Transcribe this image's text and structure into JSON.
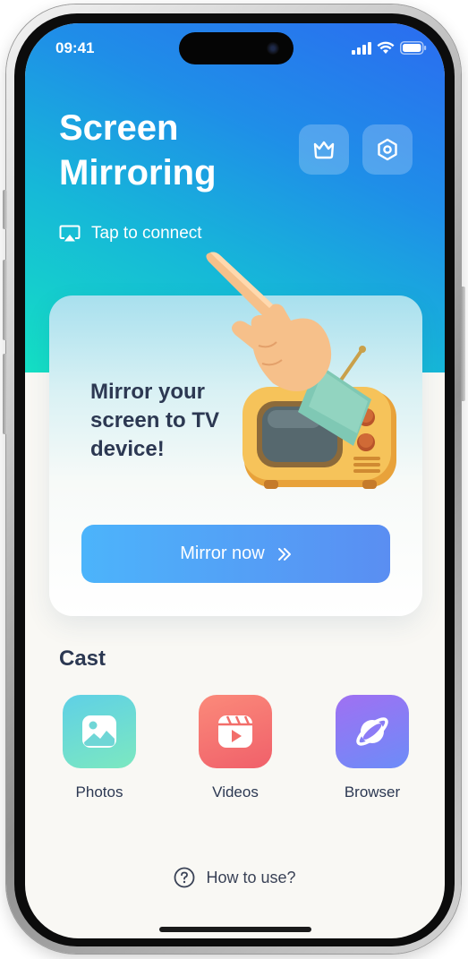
{
  "status": {
    "time": "09:41",
    "icons": [
      "signal-icon",
      "wifi-icon",
      "battery-icon"
    ]
  },
  "header": {
    "title_line1": "Screen",
    "title_line2": "Mirroring",
    "crown_icon": "crown-icon",
    "settings_icon": "settings-icon",
    "tap_label": "Tap to connect",
    "tap_icon": "airplay-icon"
  },
  "card": {
    "headline": "Mirror your screen to TV device!",
    "button_label": "Mirror now",
    "button_icon": "double-chevron-right-icon"
  },
  "cast": {
    "title": "Cast",
    "items": [
      {
        "label": "Photos",
        "icon": "photos-icon",
        "color": "#7ce0c0"
      },
      {
        "label": "Videos",
        "icon": "videos-icon",
        "color": "#f47a6c"
      },
      {
        "label": "Browser",
        "icon": "browser-icon",
        "color": "#8a76f4"
      }
    ]
  },
  "footer": {
    "help_label": "How to use?",
    "help_icon": "question-circle-icon"
  },
  "colors": {
    "hero_start": "#2b6cf0",
    "hero_end": "#14e0c4",
    "text_dark": "#2c3852",
    "button_start": "#4cb4fb",
    "button_end": "#5a8ef2",
    "background": "#f9f8f4"
  }
}
